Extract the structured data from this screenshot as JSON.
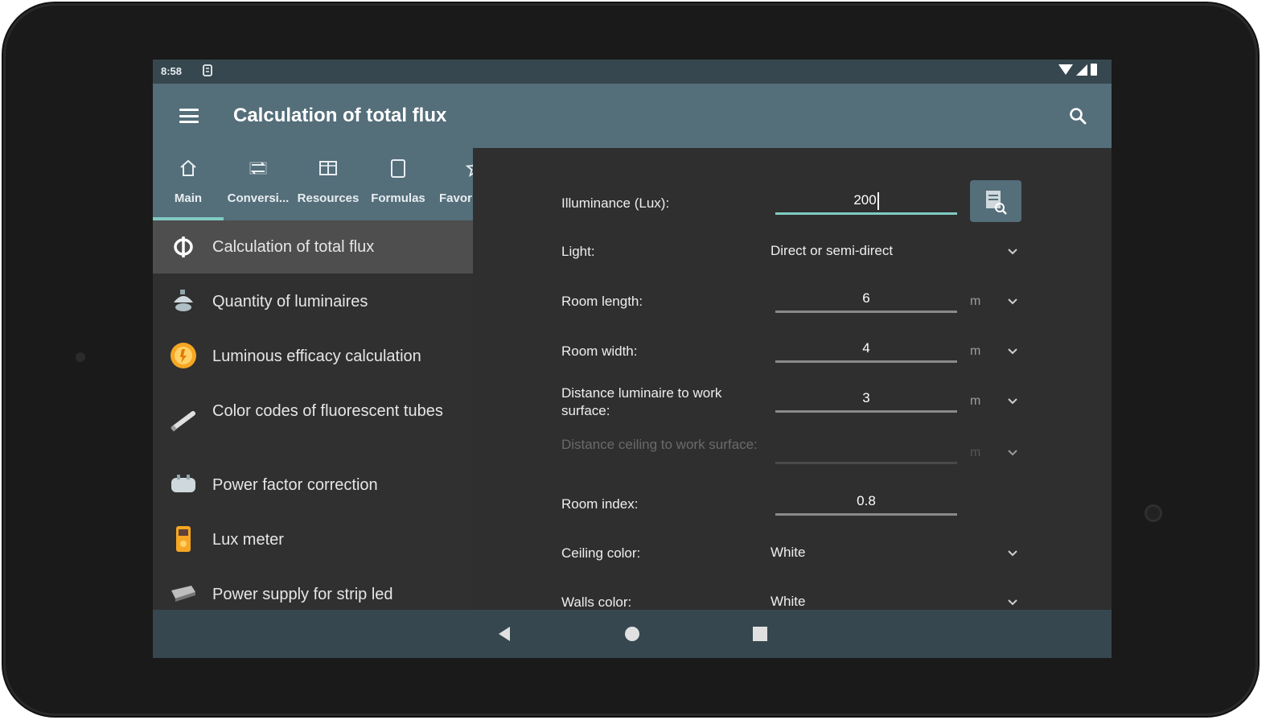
{
  "status": {
    "time": "8:58",
    "notification_icon": "storage-icon"
  },
  "appbar": {
    "title": "Calculation of total flux"
  },
  "tabs": [
    {
      "label": "Main",
      "icon": "home-icon"
    },
    {
      "label": "Conversi...",
      "icon": "conversion-icon"
    },
    {
      "label": "Resources",
      "icon": "book-icon"
    },
    {
      "label": "Formulas",
      "icon": "tablet-icon"
    },
    {
      "label": "Favor",
      "icon": "star-icon"
    }
  ],
  "nav": [
    {
      "label": "Calculation of total flux",
      "icon": "phi-icon",
      "active": true
    },
    {
      "label": "Quantity of luminaires",
      "icon": "luminaire-icon"
    },
    {
      "label": "Luminous efficacy calculation",
      "icon": "efficacy-icon"
    },
    {
      "label": "Color codes of fluorescent tubes",
      "icon": "tube-icon"
    },
    {
      "label": "Power factor correction",
      "icon": "capacitor-icon"
    },
    {
      "label": "Lux meter",
      "icon": "luxmeter-icon"
    },
    {
      "label": "Power supply for strip led",
      "icon": "power-supply-icon"
    }
  ],
  "form": {
    "illuminance": {
      "label": "Illuminance (Lux):",
      "value": "200"
    },
    "light": {
      "label": "Light:",
      "value": "Direct or semi-direct"
    },
    "room_length": {
      "label": "Room length:",
      "value": "6",
      "unit": "m"
    },
    "room_width": {
      "label": "Room width:",
      "value": "4",
      "unit": "m"
    },
    "dist_luminaire": {
      "label": "Distance luminaire to work surface:",
      "value": "3",
      "unit": "m"
    },
    "dist_ceiling": {
      "label": "Distance ceiling to work surface:",
      "value": "",
      "unit": "m"
    },
    "room_index": {
      "label": "Room index:",
      "value": "0.8"
    },
    "ceiling_color": {
      "label": "Ceiling color:",
      "value": "White"
    },
    "walls_color": {
      "label": "Walls color:",
      "value": "White"
    }
  },
  "colors": {
    "appbar": "#546e7a",
    "statusbar": "#37474f",
    "accent": "#80cbc4",
    "background": "#303030"
  }
}
